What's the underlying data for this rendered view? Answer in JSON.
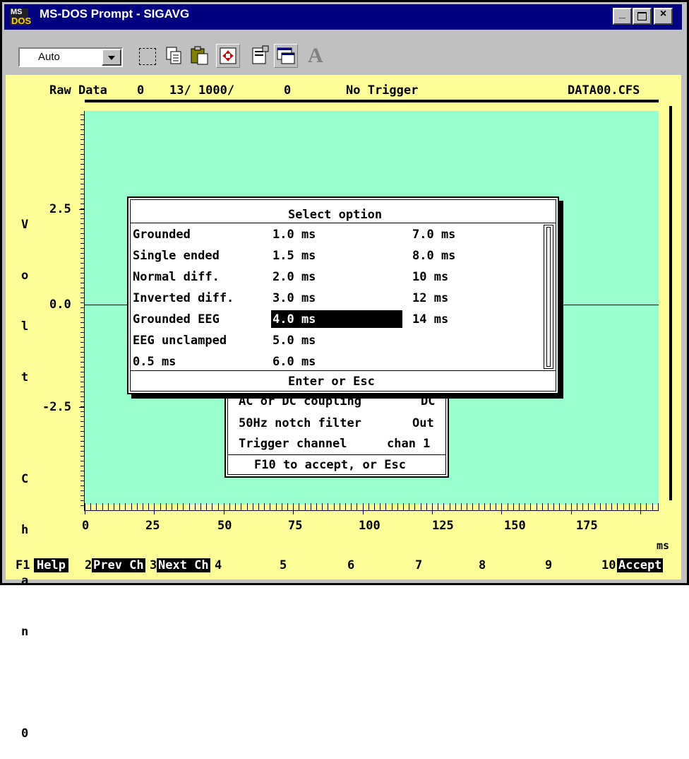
{
  "window": {
    "title": "MS-DOS Prompt - SIGAVG"
  },
  "toolbar": {
    "font_size_value": "Auto",
    "tools": [
      "mark-icon",
      "copy-icon",
      "paste-icon",
      "fullscreen-icon",
      "properties-icon",
      "background-icon",
      "font-icon"
    ]
  },
  "status": {
    "mode": "Raw Data",
    "val1": "0",
    "sweep": "13/ 1000/",
    "val2": "0",
    "trigger": "No Trigger",
    "file": "DATA00.CFS"
  },
  "axis": {
    "ylabel": [
      "V",
      "o",
      "l",
      "t",
      "",
      "C",
      "h",
      "a",
      "n",
      "",
      "0"
    ],
    "yticks": [
      "2.5",
      "0.0",
      "-2.5"
    ],
    "xticks": [
      "0",
      "25",
      "50",
      "75",
      "100",
      "125",
      "150",
      "175"
    ],
    "xunit": "ms"
  },
  "dialog": {
    "title": "Select option",
    "col1": [
      "Grounded",
      "Single ended",
      "Normal diff.",
      "Inverted diff.",
      "Grounded EEG",
      "EEG unclamped",
      "0.5 ms"
    ],
    "col2": [
      "1.0 ms",
      "1.5 ms",
      "2.0 ms",
      "3.0 ms",
      "4.0 ms",
      "5.0 ms",
      "6.0 ms"
    ],
    "col3": [
      "7.0 ms",
      "8.0 ms",
      "10 ms",
      "12 ms",
      "14 ms"
    ],
    "selected": "4.0 ms",
    "footer": "Enter or Esc"
  },
  "settings": {
    "rows": [
      {
        "label": "AC or DC coupling",
        "value": "DC"
      },
      {
        "label": "50Hz notch filter",
        "value": "Out"
      },
      {
        "label": "Trigger channel",
        "value": "chan 1"
      }
    ],
    "footer": "F10 to accept, or Esc"
  },
  "fkeys": [
    {
      "num": "F1",
      "label": "Help"
    },
    {
      "num": "2",
      "label": "Prev Ch"
    },
    {
      "num": "3",
      "label": "Next Ch"
    },
    {
      "num": "4",
      "label": ""
    },
    {
      "num": "5",
      "label": ""
    },
    {
      "num": "6",
      "label": ""
    },
    {
      "num": "7",
      "label": ""
    },
    {
      "num": "8",
      "label": ""
    },
    {
      "num": "9",
      "label": ""
    },
    {
      "num": "10",
      "label": "Accept"
    }
  ]
}
